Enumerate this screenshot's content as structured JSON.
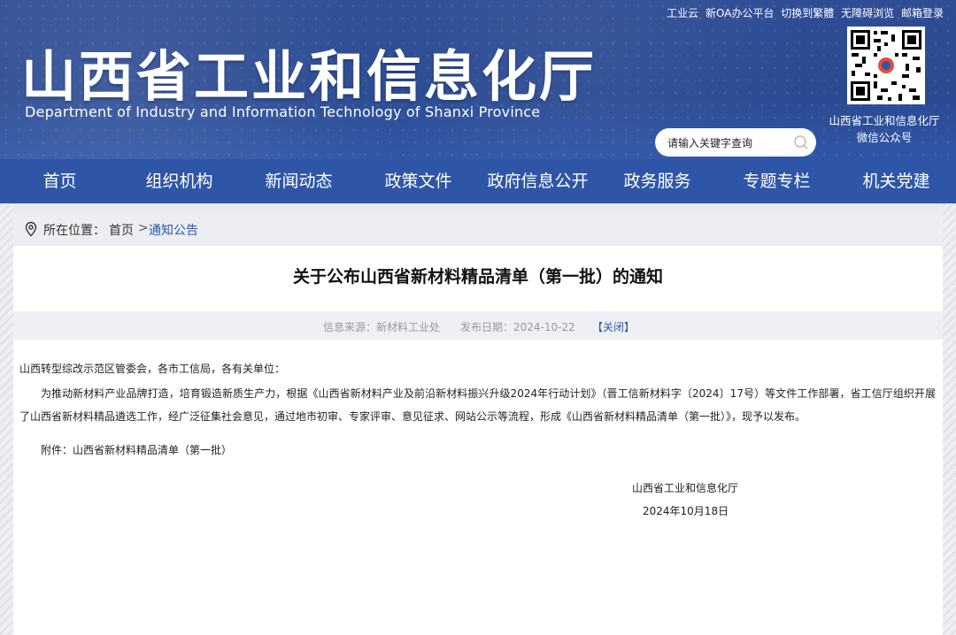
{
  "header": {
    "top_links": [
      "工业云",
      "新OA办公平台",
      "切换到繁體",
      "无障碍浏览",
      "邮箱登录"
    ],
    "title": "山西省工业和信息化厅",
    "subtitle": "Department of Industry and Information Technology of Shanxi Province",
    "qr_caption_line1": "山西省工业和信息化厅",
    "qr_caption_line2": "微信公众号",
    "search_placeholder": "请输入关键字查询"
  },
  "nav": [
    "首页",
    "组织机构",
    "新闻动态",
    "政策文件",
    "政府信息公开",
    "政务服务",
    "专题专栏",
    "机关党建"
  ],
  "breadcrumb": {
    "label": "所在位置：",
    "home": "首页",
    "separator": ">",
    "current": "通知公告"
  },
  "article": {
    "title": "关于公布山西省新材料精品清单（第一批）的通知",
    "source": "信息来源：新材料工业处",
    "date": "发布日期：2024-10-22",
    "close_label": "【关闭】",
    "greeting": "山西转型综改示范区管委会，各市工信局，各有关单位：",
    "paragraph": "为推动新材料产业品牌打造，培育锻造新质生产力，根据《山西省新材料产业及前沿新材料振兴升级2024年行动计划》（晋工信新材料字〔2024〕17号）等文件工作部署，省工信厅组织开展了山西省新材料精品遴选工作，经广泛征集社会意见，通过地市初审、专家评审、意见征求、网站公示等流程，形成《山西省新材料精品清单（第一批）》，现予以发布。",
    "attachment": "附件：山西省新材料精品清单（第一批）",
    "signature_org": "山西省工业和信息化厅",
    "signature_date": "2024年10月18日"
  },
  "colors": {
    "header_blue": "#2e4d95",
    "nav_blue": "#2f56a6",
    "link_blue": "#2f56a6"
  }
}
